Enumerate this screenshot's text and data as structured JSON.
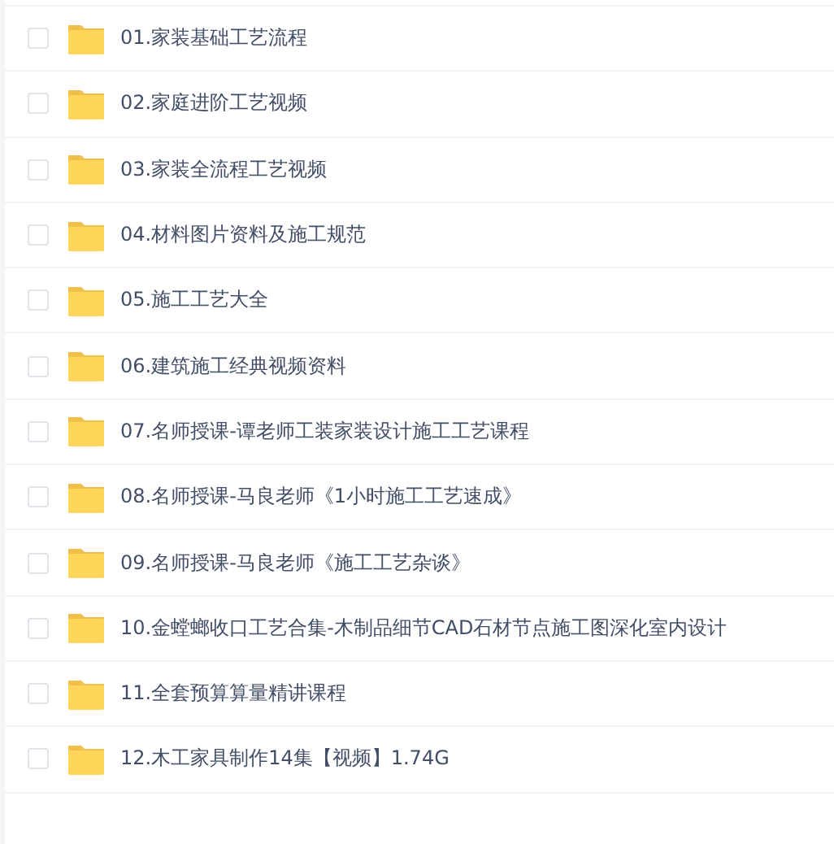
{
  "files": [
    {
      "name": "01.家装基础工艺流程",
      "kind": "folder",
      "checked": false
    },
    {
      "name": "02.家庭进阶工艺视频",
      "kind": "folder",
      "checked": false
    },
    {
      "name": "03.家装全流程工艺视频",
      "kind": "folder",
      "checked": false
    },
    {
      "name": "04.材料图片资料及施工规范",
      "kind": "folder",
      "checked": false
    },
    {
      "name": "05.施工工艺大全",
      "kind": "folder",
      "checked": false
    },
    {
      "name": "06.建筑施工经典视频资料",
      "kind": "folder",
      "checked": false
    },
    {
      "name": "07.名师授课-谭老师工装家装设计施工工艺课程",
      "kind": "folder",
      "checked": false
    },
    {
      "name": "08.名师授课-马良老师《1小时施工工艺速成》",
      "kind": "folder",
      "checked": false
    },
    {
      "name": "09.名师授课-马良老师《施工工艺杂谈》",
      "kind": "folder",
      "checked": false
    },
    {
      "name": "10.金螳螂收口工艺合集-木制品细节CAD石材节点施工图深化室内设计",
      "kind": "folder",
      "checked": false
    },
    {
      "name": "11.全套预算算量精讲课程",
      "kind": "folder",
      "checked": false
    },
    {
      "name": "12.木工家具制作14集【视频】1.74G",
      "kind": "folder",
      "checked": false
    }
  ]
}
